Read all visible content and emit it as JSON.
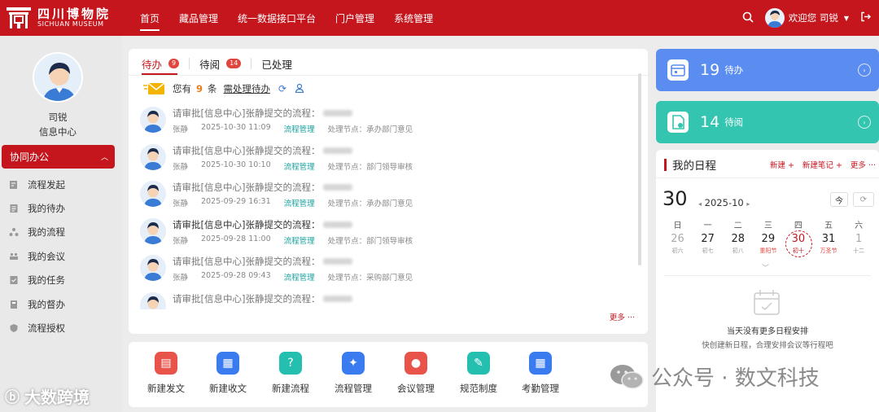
{
  "brand": {
    "name_cn": "四川博物院",
    "name_en": "SICHUAN MUSEUM",
    "logo_icon": "museum-gate-icon"
  },
  "nav": {
    "items": [
      {
        "label": "首页",
        "active": true
      },
      {
        "label": "藏品管理"
      },
      {
        "label": "统一数据接口平台"
      },
      {
        "label": "门户管理"
      },
      {
        "label": "系统管理"
      }
    ]
  },
  "user": {
    "welcome": "欢迎您 司锐",
    "name": "司锐",
    "dept": "信息中心"
  },
  "sidebar": {
    "group_label": "协同办公",
    "items": [
      {
        "label": "流程发起",
        "icon": "edit-doc-icon"
      },
      {
        "label": "我的待办",
        "icon": "doc-list-icon"
      },
      {
        "label": "我的流程",
        "icon": "flow-icon"
      },
      {
        "label": "我的会议",
        "icon": "meeting-icon"
      },
      {
        "label": "我的任务",
        "icon": "task-icon"
      },
      {
        "label": "我的督办",
        "icon": "supervise-icon"
      },
      {
        "label": "流程授权",
        "icon": "authorize-icon"
      }
    ]
  },
  "tasks": {
    "tabs": [
      {
        "label": "待办",
        "badge": "9",
        "active": true
      },
      {
        "label": "待阅",
        "badge": "14"
      },
      {
        "label": "已处理"
      }
    ],
    "notice": {
      "prefix": "您有",
      "count": "9",
      "unit": "条",
      "link": "需处理待办"
    },
    "items": [
      {
        "title": "请审批[信息中心]张静提交的流程：",
        "user": "张静",
        "time": "2025-10-30 11:09",
        "flow": "流程管理",
        "node": "处理节点：承办部门意见"
      },
      {
        "title": "请审批[信息中心]张静提交的流程：",
        "user": "张静",
        "time": "2025-10-30 10:10",
        "flow": "流程管理",
        "node": "处理节点：部门领导审核"
      },
      {
        "title": "请审批[信息中心]张静提交的流程：",
        "user": "张静",
        "time": "2025-09-29 16:31",
        "flow": "流程管理",
        "node": "处理节点：承办部门意见"
      },
      {
        "title": "请审批[信息中心]张静提交的流程：",
        "user": "张静",
        "time": "2025-09-28 11:00",
        "flow": "流程管理",
        "node": "处理节点：部门领导审核"
      },
      {
        "title": "请审批[信息中心]张静提交的流程：",
        "user": "张静",
        "time": "2025-09-28 09:43",
        "flow": "流程管理",
        "node": "处理节点：采购部门意见"
      },
      {
        "title": "请审批[信息中心]张静提交的流程：",
        "user": "",
        "time": "",
        "flow": "",
        "node": ""
      }
    ],
    "more": "更多 ···"
  },
  "quick_actions": [
    {
      "label": "新建发文",
      "color": "#e8534a",
      "icon": "doc-icon"
    },
    {
      "label": "新建收文",
      "color": "#3a7bf0",
      "icon": "inbox-icon"
    },
    {
      "label": "新建流程",
      "color": "#25bfb0",
      "icon": "question-icon"
    },
    {
      "label": "流程管理",
      "color": "#3a7bf0",
      "icon": "star-doc-icon"
    },
    {
      "label": "会议管理",
      "color": "#e8534a",
      "icon": "user-icon"
    },
    {
      "label": "规范制度",
      "color": "#25bfb0",
      "icon": "rule-icon"
    },
    {
      "label": "考勤管理",
      "color": "#3a7bf0",
      "icon": "table-icon"
    }
  ],
  "stats": {
    "pending": {
      "num": "19",
      "label": "待办",
      "color": "#5b8df0"
    },
    "toread": {
      "num": "14",
      "label": "待阅",
      "color": "#34c5b1"
    }
  },
  "schedule": {
    "title": "我的日程",
    "new": "新建 +",
    "new_note": "新建笔记 +",
    "more": "更多 ···",
    "day": "30",
    "month": "2025-10",
    "today_btn": "今",
    "weekdays": [
      "日",
      "一",
      "二",
      "三",
      "四",
      "五",
      "六"
    ],
    "days": [
      {
        "n": "26",
        "l": "初六",
        "dim": true
      },
      {
        "n": "27",
        "l": "初七"
      },
      {
        "n": "28",
        "l": "初八"
      },
      {
        "n": "29",
        "l": "重阳节",
        "red": true
      },
      {
        "n": "30",
        "l": "初十",
        "today": true
      },
      {
        "n": "31",
        "l": "万圣节",
        "red": true
      },
      {
        "n": "1",
        "l": "十二",
        "dim": true
      }
    ],
    "empty_title": "当天没有更多日程安排",
    "empty_sub": "快创建新日程，合理安排会议等行程吧"
  },
  "watermarks": {
    "wechat": "公众号 · 数文科技",
    "bottom": "大数跨境"
  }
}
